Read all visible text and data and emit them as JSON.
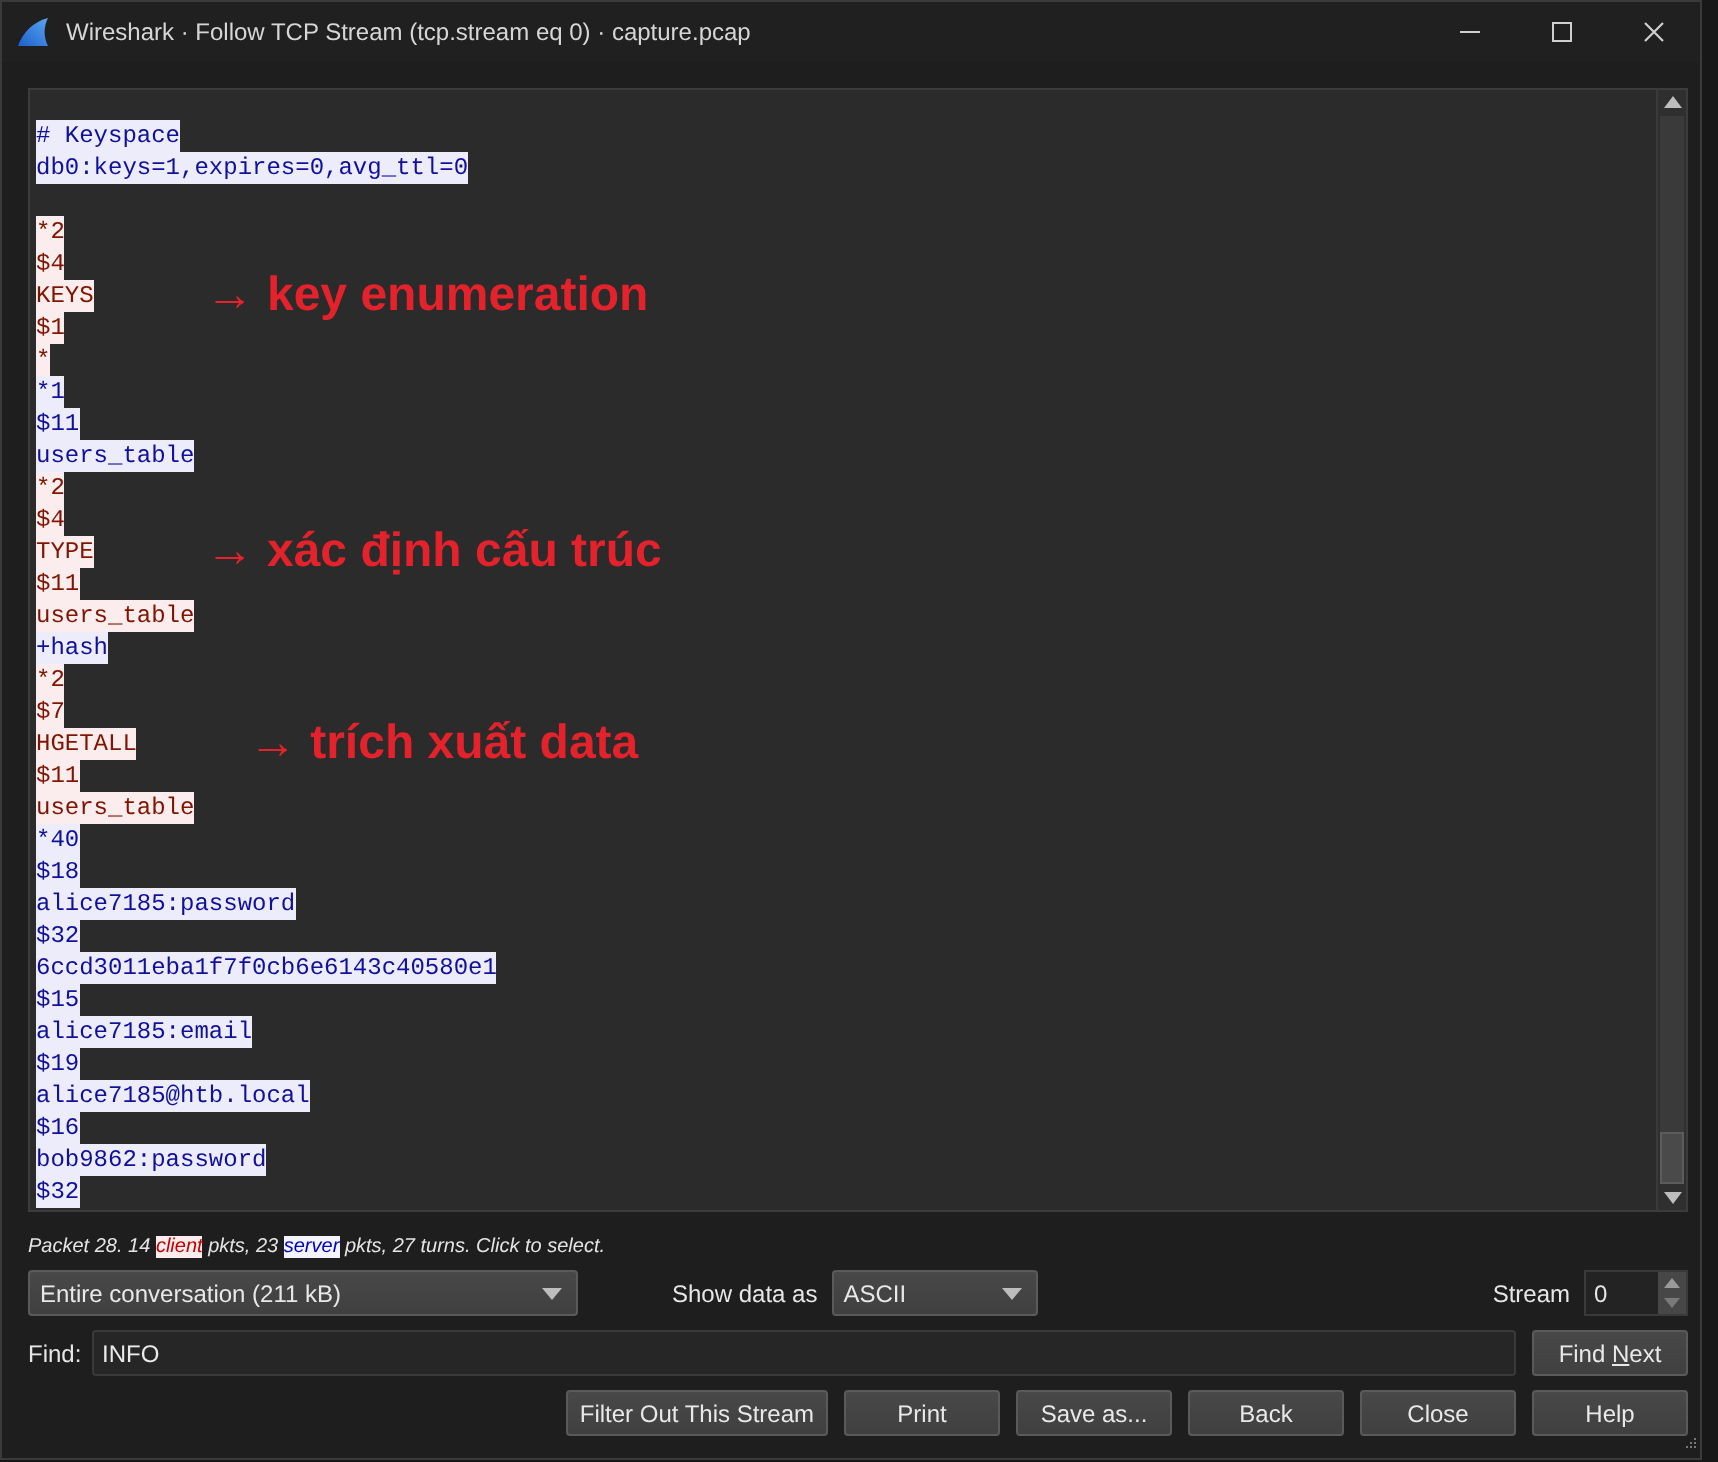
{
  "window": {
    "title": "Wireshark · Follow TCP Stream (tcp.stream eq 0) · capture.pcap"
  },
  "stream": {
    "lines": [
      {
        "text": "# Keyspace",
        "kind": "server"
      },
      {
        "text": "db0:keys=1,expires=0,avg_ttl=0",
        "kind": "server"
      },
      {
        "kind": "blank"
      },
      {
        "text": "*2",
        "kind": "client"
      },
      {
        "text": "$4",
        "kind": "client"
      },
      {
        "text": "KEYS",
        "kind": "client",
        "annotation": "→ key enumeration"
      },
      {
        "text": "$1",
        "kind": "client"
      },
      {
        "text": "*",
        "kind": "client"
      },
      {
        "text": "*1",
        "kind": "server"
      },
      {
        "text": "$11",
        "kind": "server"
      },
      {
        "text": "users_table",
        "kind": "server"
      },
      {
        "text": "*2",
        "kind": "client"
      },
      {
        "text": "$4",
        "kind": "client"
      },
      {
        "text": "TYPE",
        "kind": "client",
        "annotation": "→ xác định cấu trúc"
      },
      {
        "text": "$11",
        "kind": "client"
      },
      {
        "text": "users_table",
        "kind": "client"
      },
      {
        "text": "+hash",
        "kind": "server"
      },
      {
        "text": "*2",
        "kind": "client"
      },
      {
        "text": "$7",
        "kind": "client"
      },
      {
        "text": "HGETALL",
        "kind": "client",
        "annotation": "→ trích xuất data"
      },
      {
        "text": "$11",
        "kind": "client"
      },
      {
        "text": "users_table",
        "kind": "client"
      },
      {
        "text": "*40",
        "kind": "server"
      },
      {
        "text": "$18",
        "kind": "server"
      },
      {
        "text": "alice7185:password",
        "kind": "server"
      },
      {
        "text": "$32",
        "kind": "server"
      },
      {
        "text": "6ccd3011eba1f7f0cb6e6143c40580e1",
        "kind": "server"
      },
      {
        "text": "$15",
        "kind": "server"
      },
      {
        "text": "alice7185:email",
        "kind": "server"
      },
      {
        "text": "$19",
        "kind": "server"
      },
      {
        "text": "alice7185@htb.local",
        "kind": "server"
      },
      {
        "text": "$16",
        "kind": "server"
      },
      {
        "text": "bob9862:password",
        "kind": "server"
      },
      {
        "text": "$32",
        "kind": "server"
      }
    ]
  },
  "status": {
    "parts": [
      {
        "text": "Packet 28. 14 ",
        "kind": "plain"
      },
      {
        "text": "client",
        "kind": "client"
      },
      {
        "text": " pkts, 23 ",
        "kind": "plain"
      },
      {
        "text": "server",
        "kind": "server"
      },
      {
        "text": " pkts, 27 turns. Click to select.",
        "kind": "plain"
      }
    ]
  },
  "options": {
    "conversation": {
      "value": "Entire conversation (211 kB)"
    },
    "show_data_as": {
      "label": "Show data as",
      "value": "ASCII"
    },
    "stream": {
      "label": "Stream",
      "value": "0"
    }
  },
  "find": {
    "label": "Find:",
    "value": "INFO",
    "button": {
      "label": "Find Next",
      "accelerator_underlined": true
    }
  },
  "buttons": [
    "Filter Out This Stream",
    "Print",
    "Save as...",
    "Back",
    "Close",
    "Help"
  ]
}
